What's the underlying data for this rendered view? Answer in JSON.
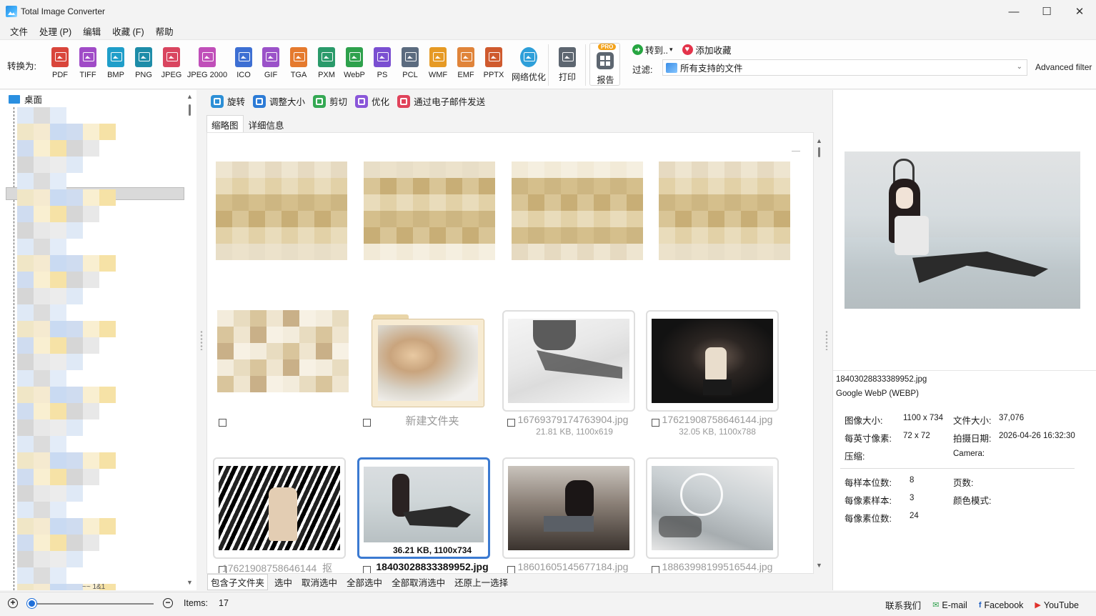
{
  "window": {
    "title": "Total Image Converter"
  },
  "menu": [
    "文件",
    "处理 (P)",
    "编辑",
    "收藏 (F)",
    "帮助"
  ],
  "toolbar": {
    "convert_label": "转换为:",
    "formats": [
      {
        "label": "PDF",
        "color": "#d9453b"
      },
      {
        "label": "TIFF",
        "color": "#a04bc7"
      },
      {
        "label": "BMP",
        "color": "#1f9ec9"
      },
      {
        "label": "PNG",
        "color": "#1d8ca8"
      },
      {
        "label": "JPEG",
        "color": "#d9455f"
      },
      {
        "label": "JPEG 2000",
        "color": "#c04fb9"
      },
      {
        "label": "ICO",
        "color": "#3d6fd3"
      },
      {
        "label": "GIF",
        "color": "#9b52c9"
      },
      {
        "label": "TGA",
        "color": "#e57a2e"
      },
      {
        "label": "PXM",
        "color": "#2a9a6a"
      },
      {
        "label": "WebP",
        "color": "#2ea14c"
      },
      {
        "label": "PS",
        "color": "#7a4fd1"
      },
      {
        "label": "PCL",
        "color": "#5b6b7f"
      },
      {
        "label": "WMF",
        "color": "#e69a24"
      },
      {
        "label": "EMF",
        "color": "#e0843a"
      },
      {
        "label": "PPTX",
        "color": "#cf5a2e"
      },
      {
        "label": "网络优化",
        "color": "#2e9fd9"
      }
    ],
    "print_label": "打印",
    "report_label": "报告",
    "pro_badge": "PRO",
    "goto_label": "转到..",
    "goto_arrow": "▾",
    "favorite_label": "添加收藏",
    "filter_label": "过滤:",
    "filter_value": "所有支持的文件",
    "advanced_filter": "Advanced filter"
  },
  "tree": {
    "root_label": "桌面",
    "bottom_partial": "~~ 1&1"
  },
  "actions": [
    {
      "label": "旋转",
      "color": "#2c8fd6"
    },
    {
      "label": "调整大小",
      "color": "#2c7bd6"
    },
    {
      "label": "剪切",
      "color": "#34a853"
    },
    {
      "label": "优化",
      "color": "#8a56d9"
    },
    {
      "label": "通过电子邮件发送",
      "color": "#e0425a"
    }
  ],
  "tabs": [
    "缩略图",
    "详细信息"
  ],
  "thumbnails": [
    {
      "name": "新建文件夹"
    },
    {
      "name": "16769379174763904.jpg",
      "info": "21.81 KB, 1100x619"
    },
    {
      "name": "17621908758646144.jpg",
      "info": "32.05 KB, 1100x788"
    },
    {
      "name": "17621908758646144_抠",
      "info": ""
    },
    {
      "name": "18403028833389952.jpg",
      "info": "36.21 KB, 1100x734"
    },
    {
      "name": "18601605145677184.jpg",
      "info": ""
    },
    {
      "name": "18863998199516544.jpg",
      "info": ""
    }
  ],
  "bottom_buttons": [
    "包含子文件夹",
    "选中",
    "取消选中",
    "全部选中",
    "全部取消选中",
    "还原上一选择"
  ],
  "preview": {
    "file_name": "18403028833389952.jpg",
    "file_type": "Google WebP (WEBP)",
    "image_size_label": "图像大小:",
    "image_size": "1100 x 734",
    "file_size_label": "文件大小:",
    "file_size": "37,076",
    "dpi_label": "每英寸像素:",
    "dpi": "72 x 72",
    "date_label": "拍摄日期:",
    "date": "2026-04-26 16:32:30",
    "compression_label": "压缩:",
    "camera_label": "Camera:",
    "bits_per_sample_label": "每样本位数:",
    "bits_per_sample": "8",
    "pages_label": "页数:",
    "samples_per_pixel_label": "每像素样本:",
    "samples_per_pixel": "3",
    "color_mode_label": "颜色模式:",
    "bits_per_pixel_label": "每像素位数:",
    "bits_per_pixel": "24"
  },
  "status": {
    "items_label": "Items:",
    "items_count": "17",
    "contact": "联系我们",
    "email": "E-mail",
    "facebook": "Facebook",
    "youtube": "YouTube"
  }
}
